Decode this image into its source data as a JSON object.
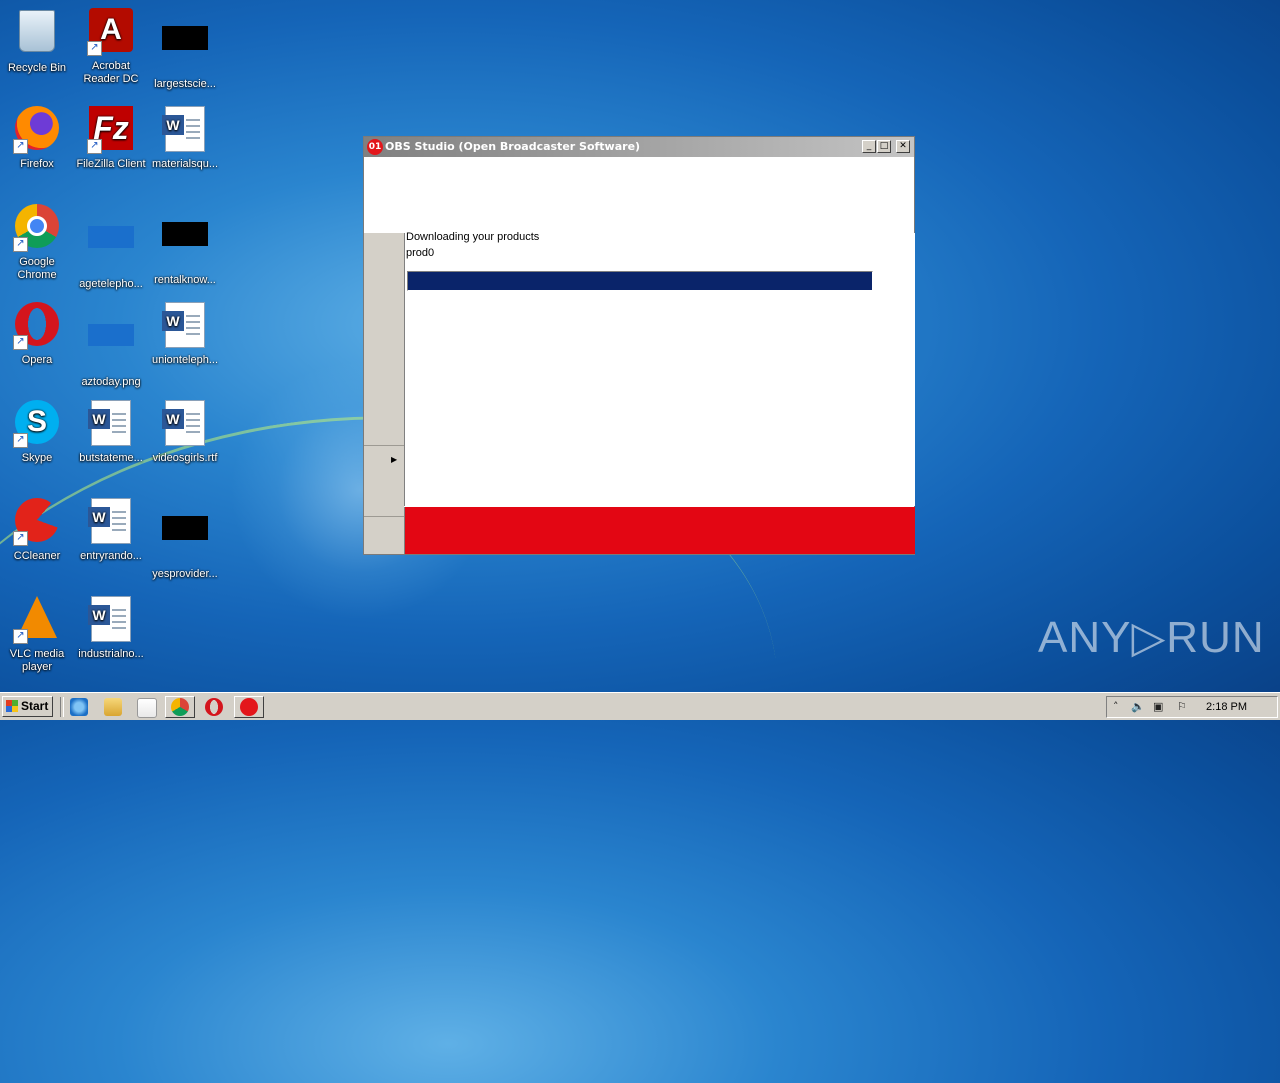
{
  "desktop": {
    "icons": [
      {
        "label": "Recycle Bin",
        "icon": "recycle-bin-icon"
      },
      {
        "label": "Acrobat Reader DC",
        "icon": "acrobat-icon"
      },
      {
        "label": "largestscie...",
        "icon": "redacted-file-icon"
      },
      {
        "label": "Firefox",
        "icon": "firefox-icon"
      },
      {
        "label": "FileZilla Client",
        "icon": "filezilla-icon"
      },
      {
        "label": "materialsqu...",
        "icon": "word-document-icon"
      },
      {
        "label": "Google Chrome",
        "icon": "chrome-icon"
      },
      {
        "label": "agetelepho...",
        "icon": "image-file-icon"
      },
      {
        "label": "rentalknow...",
        "icon": "redacted-file-icon"
      },
      {
        "label": "Opera",
        "icon": "opera-icon"
      },
      {
        "label": "aztoday.png",
        "icon": "image-file-icon"
      },
      {
        "label": "unionteleph...",
        "icon": "word-document-icon"
      },
      {
        "label": "Skype",
        "icon": "skype-icon"
      },
      {
        "label": "butstateme...",
        "icon": "word-document-icon"
      },
      {
        "label": "videosgirls.rtf",
        "icon": "word-document-icon"
      },
      {
        "label": "CCleaner",
        "icon": "ccleaner-icon"
      },
      {
        "label": "entryrando...",
        "icon": "word-document-icon"
      },
      {
        "label": "yesprovider...",
        "icon": "redacted-file-icon"
      },
      {
        "label": "VLC media player",
        "icon": "vlc-icon"
      },
      {
        "label": "industrialno...",
        "icon": "word-document-icon"
      }
    ]
  },
  "window": {
    "title": "OBS Studio (Open Broadcaster Software)",
    "app_badge": "01",
    "minimize": "_",
    "maximize": "□",
    "close": "✕",
    "status_line": "Downloading your products",
    "current_item": "prod0",
    "progress": 1.0,
    "band_color": "#e30613"
  },
  "watermark": "ANY▷RUN",
  "taskbar": {
    "start_label": "Start",
    "tray_time": "2:18 PM"
  }
}
